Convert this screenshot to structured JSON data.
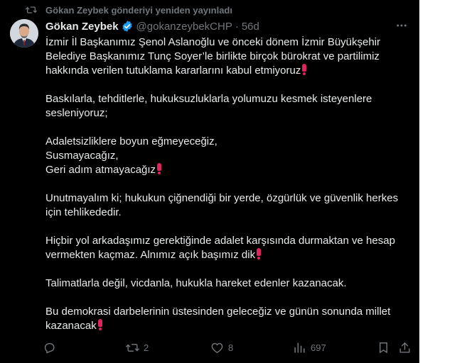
{
  "repost": {
    "text": "Gökan Zeybek gönderiyi yeniden yayınladı",
    "icon": "repost-icon"
  },
  "author": {
    "name": "Gökan Zeybek",
    "handle": "@gokanzeybekCHP",
    "separator": "·",
    "time": "56d",
    "verified": true
  },
  "tweet": {
    "paragraphs": [
      {
        "lines": [
          {
            "text": "İzmir İl Başkanımız Şenol Aslanoğlu ve önceki dönem İzmir Büyükşehir"
          },
          {
            "text": "Belediye Başkanımız Tunç Soyer’le birlikte birçok bürokrat ve partilimiz"
          },
          {
            "text": "hakkında verilen tutuklama kararlarını kabul etmiyoruz",
            "emoji": "❗"
          }
        ]
      },
      {
        "lines": [
          {
            "text": "Baskılarla, tehditlerle, hukuksuzluklarla yolumuzu kesmek isteyenlere"
          },
          {
            "text": "sesleniyoruz;"
          }
        ]
      },
      {
        "lines": [
          {
            "text": "Adaletsizliklere boyun eğmeyeceğiz,"
          },
          {
            "text": "Susmayacağız,"
          },
          {
            "text": "Geri adım atmayacağız",
            "emoji": "❗"
          }
        ]
      },
      {
        "lines": [
          {
            "text": "Unutmayalım ki; hukukun çiğnendiği bir yerde, özgürlük ve güvenlik herkes"
          },
          {
            "text": "için tehlikededir."
          }
        ]
      },
      {
        "lines": [
          {
            "text": "Hiçbir yol arkadaşımız gerektiğinde adalet karşısında durmaktan ve hesap"
          },
          {
            "text": "vermekten kaçmaz. Alnımız açık başımız dik",
            "emoji": "❗"
          }
        ]
      },
      {
        "lines": [
          {
            "text": "Talimatlarla değil, vicdanla, hukukla hareket edenler kazanacak."
          }
        ]
      },
      {
        "lines": [
          {
            "text": "Bu demokrasi darbelerinin üstesinden geleceğiz ve günün sonunda millet"
          },
          {
            "text": "kazanacak",
            "emoji": "❗"
          }
        ]
      }
    ]
  },
  "actions": {
    "reply": {
      "icon": "reply-icon",
      "count": ""
    },
    "repost": {
      "icon": "repost-icon",
      "count": "2"
    },
    "like": {
      "icon": "heart-icon",
      "count": "8"
    },
    "views": {
      "icon": "views-icon",
      "count": "697"
    },
    "bookmark": {
      "icon": "bookmark-icon"
    },
    "share": {
      "icon": "share-icon"
    }
  },
  "colors": {
    "background": "#000000",
    "text": "#e7e9ea",
    "muted": "#71767b",
    "verified": "#1d9bf0",
    "emoji": "#e0245e"
  }
}
